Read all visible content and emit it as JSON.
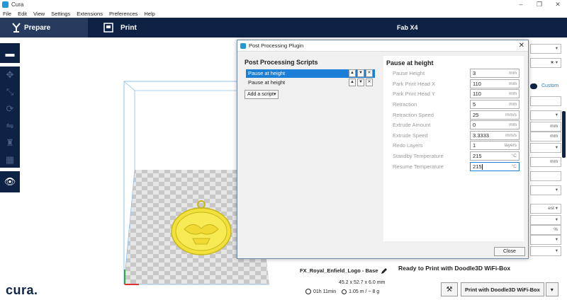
{
  "window": {
    "title": "Cura"
  },
  "menu": [
    "File",
    "Edit",
    "View",
    "Settings",
    "Extensions",
    "Preferences",
    "Help"
  ],
  "header": {
    "tab_prepare": "Prepare",
    "tab_print": "Print",
    "printer": "Fab X4"
  },
  "dialog": {
    "title": "Post Processing Plugin",
    "scripts_heading": "Post Processing Scripts",
    "scripts": [
      {
        "label": "Pause at height",
        "selected": true
      },
      {
        "label": "Pause at height",
        "selected": false
      }
    ],
    "add_script_label": "Add a script",
    "settings_heading": "Pause at height",
    "settings": [
      {
        "label": "Pause Height",
        "value": "3",
        "unit": "mm"
      },
      {
        "label": "Park Print Head X",
        "value": "110",
        "unit": "mm"
      },
      {
        "label": "Park Print Head Y",
        "value": "110",
        "unit": "mm"
      },
      {
        "label": "Retraction",
        "value": "5",
        "unit": "mm"
      },
      {
        "label": "Retraction Speed",
        "value": "25",
        "unit": "mm/s"
      },
      {
        "label": "Extrude Amount",
        "value": "0",
        "unit": "mm"
      },
      {
        "label": "Extrude Speed",
        "value": "3.3333",
        "unit": "mm/s"
      },
      {
        "label": "Redo Layers",
        "value": "1",
        "unit": "layers"
      },
      {
        "label": "Standby Temperature",
        "value": "215",
        "unit": "°C"
      },
      {
        "label": "Resume Temperature",
        "value": "215",
        "unit": "°C"
      }
    ],
    "close_label": "Close"
  },
  "model": {
    "name": "FX_Royal_Enfield_Logo - Base",
    "dimensions": "45.2 x 52.7 x 6.0 mm",
    "time": "01h 11min",
    "material": "1.05 m / ~ 8 g"
  },
  "right_panel": {
    "custom_label": "Custom",
    "units": [
      "mm",
      "mm",
      "mm",
      "%"
    ],
    "est": "est"
  },
  "status": {
    "ready": "Ready to Print with Doodle3D WiFi-Box",
    "print_button": "Print with Doodle3D WiFi-Box"
  },
  "brand": {
    "logo": "cura.",
    "accent": "#1b7fd8",
    "header_bg": "#0e2245"
  }
}
